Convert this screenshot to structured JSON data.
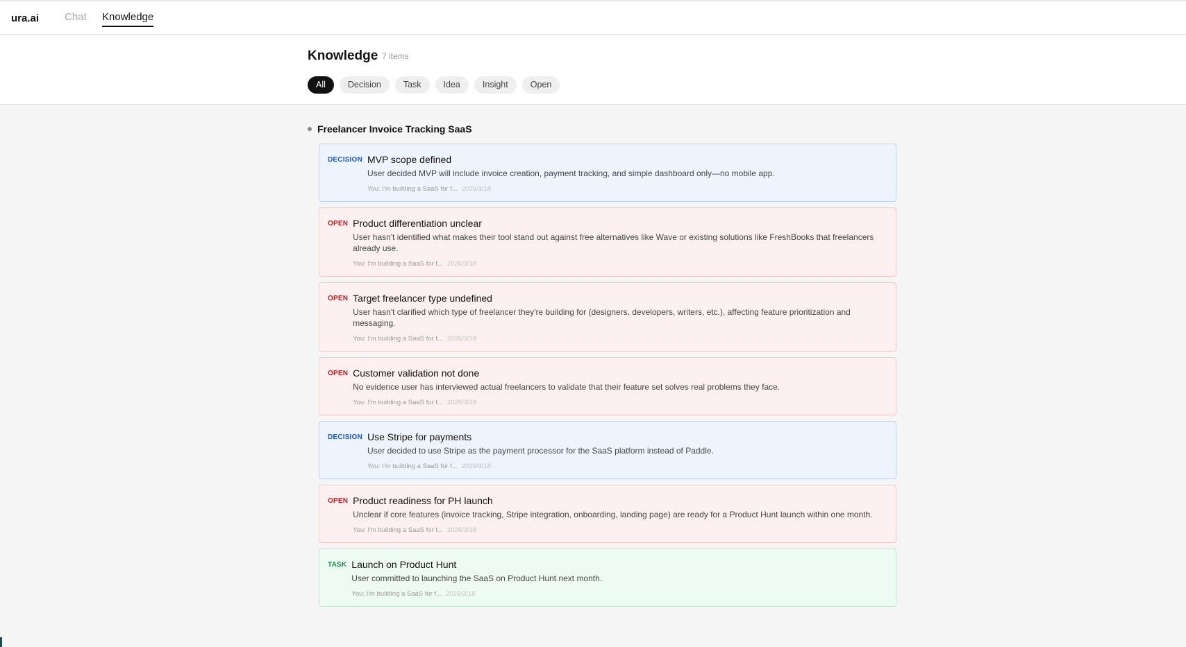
{
  "app": {
    "brand": "ura.ai"
  },
  "nav": {
    "tabs": [
      {
        "label": "Chat"
      },
      {
        "label": "Knowledge"
      }
    ],
    "active": "Knowledge"
  },
  "page": {
    "title": "Knowledge",
    "count": "7 items"
  },
  "filters": [
    "All",
    "Decision",
    "Task",
    "Idea",
    "Insight",
    "Open"
  ],
  "active_filter": "All",
  "group": {
    "title": "Freelancer Invoice Tracking SaaS"
  },
  "colors": {
    "decision": "#1f56c4",
    "open": "#c8171a",
    "task": "#1a8a45"
  },
  "cards": [
    {
      "type": "decision",
      "tag": "DECISION",
      "title": "MVP scope defined",
      "desc": "User decided MVP will include invoice creation, payment tracking, and simple dashboard only—no mobile app.",
      "source": "You: I'm building a SaaS for f...",
      "date": "2026/3/18"
    },
    {
      "type": "open",
      "tag": "OPEN",
      "title": "Product differentiation unclear",
      "desc": "User hasn't identified what makes their tool stand out against free alternatives like Wave or existing solutions like FreshBooks that freelancers already use.",
      "source": "You: I'm building a SaaS for f...",
      "date": "2026/3/18"
    },
    {
      "type": "open",
      "tag": "OPEN",
      "title": "Target freelancer type undefined",
      "desc": "User hasn't clarified which type of freelancer they're building for (designers, developers, writers, etc.), affecting feature prioritization and messaging.",
      "source": "You: I'm building a SaaS for f...",
      "date": "2026/3/18"
    },
    {
      "type": "open",
      "tag": "OPEN",
      "title": "Customer validation not done",
      "desc": "No evidence user has interviewed actual freelancers to validate that their feature set solves real problems they face.",
      "source": "You: I'm building a SaaS for f...",
      "date": "2026/3/18"
    },
    {
      "type": "decision",
      "tag": "DECISION",
      "title": "Use Stripe for payments",
      "desc": "User decided to use Stripe as the payment processor for the SaaS platform instead of Paddle.",
      "source": "You: I'm building a SaaS for f...",
      "date": "2026/3/18"
    },
    {
      "type": "open",
      "tag": "OPEN",
      "title": "Product readiness for PH launch",
      "desc": "Unclear if core features (invoice tracking, Stripe integration, onboarding, landing page) are ready for a Product Hunt launch within one month.",
      "source": "You: I'm building a SaaS for f...",
      "date": "2026/3/18"
    },
    {
      "type": "task",
      "tag": "TASK",
      "title": "Launch on Product Hunt",
      "desc": "User committed to launching the SaaS on Product Hunt next month.",
      "source": "You: I'm building a SaaS for f...",
      "date": "2026/3/18"
    }
  ]
}
